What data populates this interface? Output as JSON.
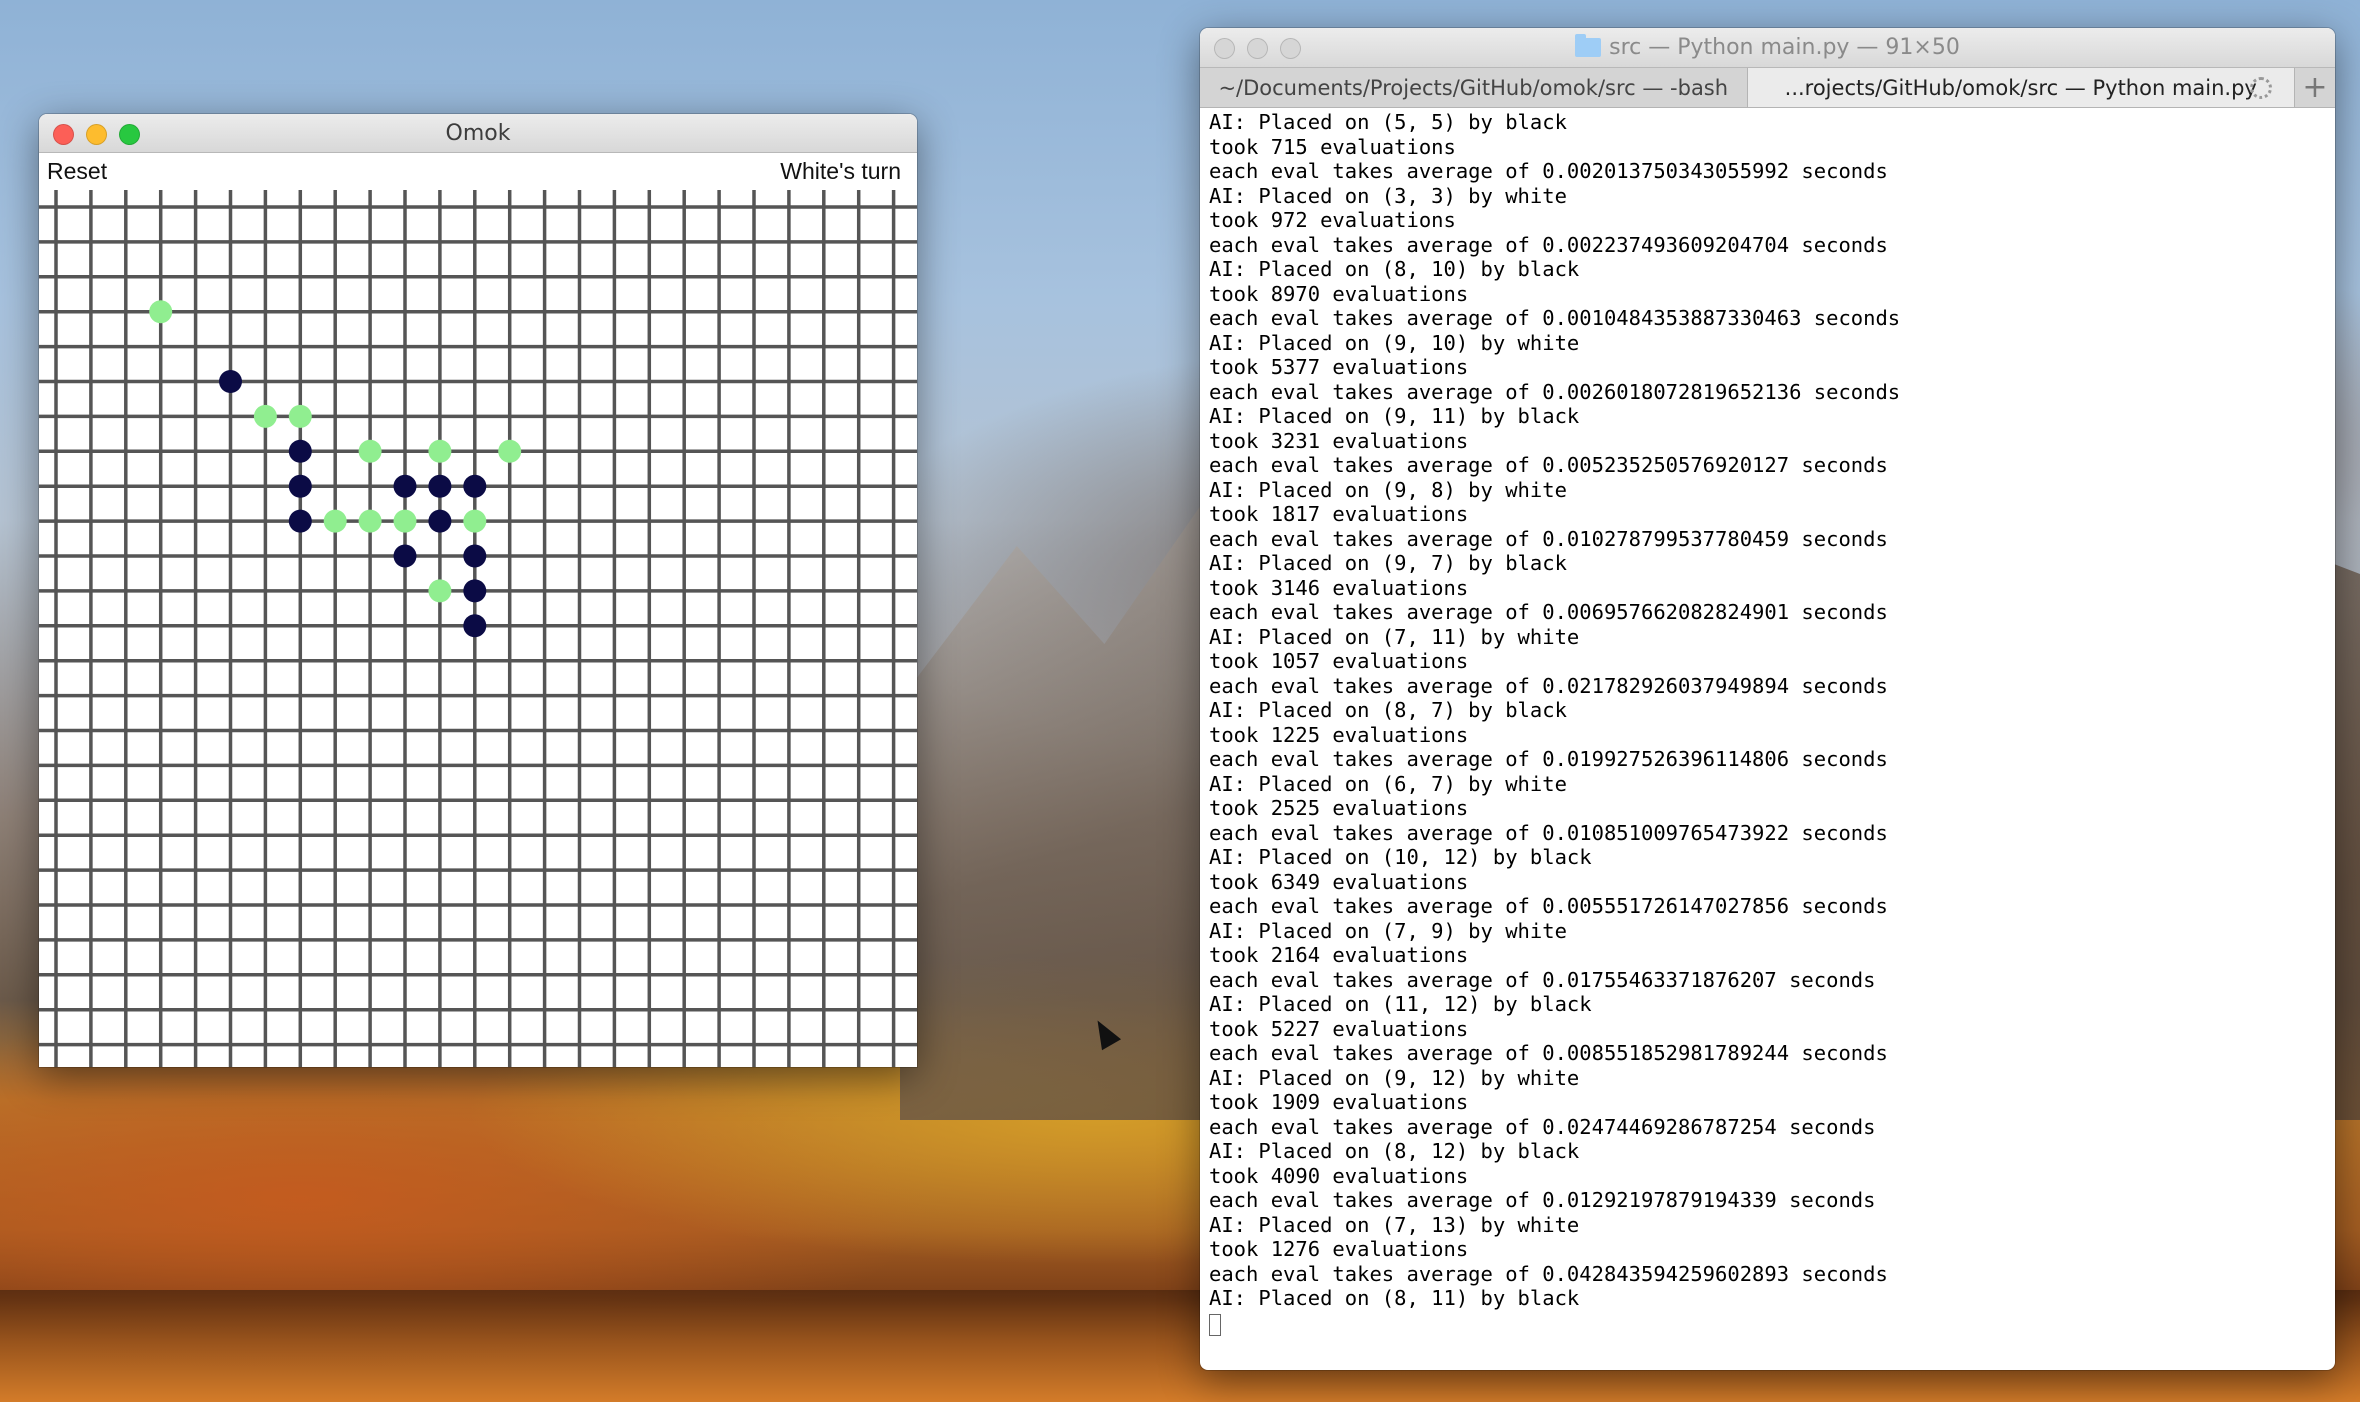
{
  "omok": {
    "title": "Omok",
    "reset_label": "Reset",
    "turn_label": "White's turn",
    "grid_line_color": "#555555",
    "stone_colors": {
      "black": "#0b0b45",
      "white": "#90ee90"
    },
    "board_size": 25,
    "stones": [
      {
        "col": 3,
        "row": 3,
        "color": "white"
      },
      {
        "col": 5,
        "row": 5,
        "color": "black"
      },
      {
        "col": 6,
        "row": 6,
        "color": "white"
      },
      {
        "col": 7,
        "row": 6,
        "color": "white"
      },
      {
        "col": 7,
        "row": 7,
        "color": "black"
      },
      {
        "col": 9,
        "row": 7,
        "color": "white"
      },
      {
        "col": 11,
        "row": 7,
        "color": "white"
      },
      {
        "col": 13,
        "row": 7,
        "color": "white"
      },
      {
        "col": 7,
        "row": 8,
        "color": "black"
      },
      {
        "col": 10,
        "row": 8,
        "color": "black"
      },
      {
        "col": 11,
        "row": 8,
        "color": "black"
      },
      {
        "col": 12,
        "row": 8,
        "color": "black"
      },
      {
        "col": 7,
        "row": 9,
        "color": "black"
      },
      {
        "col": 8,
        "row": 9,
        "color": "white"
      },
      {
        "col": 9,
        "row": 9,
        "color": "white"
      },
      {
        "col": 10,
        "row": 9,
        "color": "white"
      },
      {
        "col": 11,
        "row": 9,
        "color": "black"
      },
      {
        "col": 12,
        "row": 9,
        "color": "white"
      },
      {
        "col": 10,
        "row": 10,
        "color": "black"
      },
      {
        "col": 12,
        "row": 10,
        "color": "black"
      },
      {
        "col": 11,
        "row": 11,
        "color": "white"
      },
      {
        "col": 12,
        "row": 11,
        "color": "black"
      },
      {
        "col": 12,
        "row": 12,
        "color": "black"
      }
    ]
  },
  "terminal": {
    "title": "src — Python main.py — 91×50",
    "tabs": [
      {
        "label": "~/Documents/Projects/GitHub/omok/src — -bash"
      },
      {
        "label": "...rojects/GitHub/omok/src — Python main.py"
      }
    ],
    "new_tab_label": "+",
    "lines": [
      "AI: Placed on (5, 5) by black",
      "took 715 evaluations",
      "each eval takes average of 0.002013750343055992 seconds",
      "AI: Placed on (3, 3) by white",
      "took 972 evaluations",
      "each eval takes average of 0.002237493609204704 seconds",
      "AI: Placed on (8, 10) by black",
      "took 8970 evaluations",
      "each eval takes average of 0.0010484353887330463 seconds",
      "AI: Placed on (9, 10) by white",
      "took 5377 evaluations",
      "each eval takes average of 0.0026018072819652136 seconds",
      "AI: Placed on (9, 11) by black",
      "took 3231 evaluations",
      "each eval takes average of 0.005235250576920127 seconds",
      "AI: Placed on (9, 8) by white",
      "took 1817 evaluations",
      "each eval takes average of 0.010278799537780459 seconds",
      "AI: Placed on (9, 7) by black",
      "took 3146 evaluations",
      "each eval takes average of 0.006957662082824901 seconds",
      "AI: Placed on (7, 11) by white",
      "took 1057 evaluations",
      "each eval takes average of 0.021782926037949894 seconds",
      "AI: Placed on (8, 7) by black",
      "took 1225 evaluations",
      "each eval takes average of 0.019927526396114806 seconds",
      "AI: Placed on (6, 7) by white",
      "took 2525 evaluations",
      "each eval takes average of 0.010851009765473922 seconds",
      "AI: Placed on (10, 12) by black",
      "took 6349 evaluations",
      "each eval takes average of 0.005551726147027856 seconds",
      "AI: Placed on (7, 9) by white",
      "took 2164 evaluations",
      "each eval takes average of 0.01755463371876207 seconds",
      "AI: Placed on (11, 12) by black",
      "took 5227 evaluations",
      "each eval takes average of 0.008551852981789244 seconds",
      "AI: Placed on (9, 12) by white",
      "took 1909 evaluations",
      "each eval takes average of 0.02474469286787254 seconds",
      "AI: Placed on (8, 12) by black",
      "took 4090 evaluations",
      "each eval takes average of 0.01292197879194339 seconds",
      "AI: Placed on (7, 13) by white",
      "took 1276 evaluations",
      "each eval takes average of 0.042843594259602893 seconds",
      "AI: Placed on (8, 11) by black"
    ]
  }
}
